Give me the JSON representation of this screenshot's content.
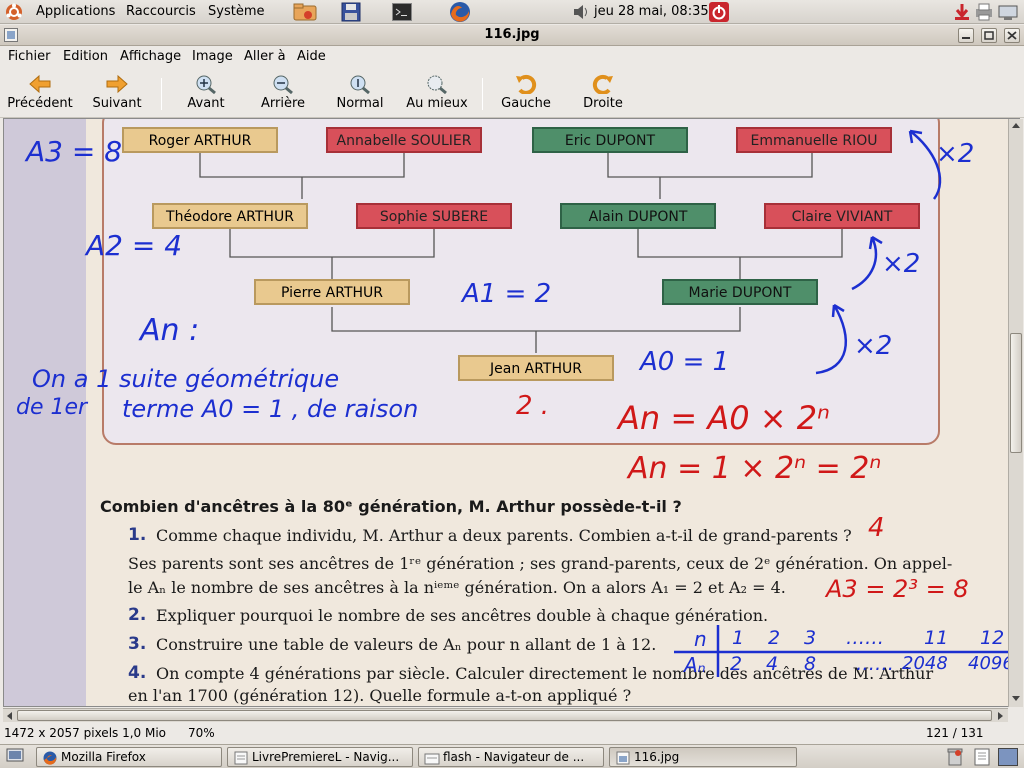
{
  "panel": {
    "applications": "Applications",
    "shortcuts": "Raccourcis",
    "system": "Système",
    "clock": "jeu 28 mai, 08:35"
  },
  "window": {
    "title": "116.jpg"
  },
  "menu": {
    "file": "Fichier",
    "edit": "Edition",
    "view": "Affichage",
    "image": "Image",
    "goto": "Aller à",
    "help": "Aide"
  },
  "toolbar": {
    "prev": "Précédent",
    "next": "Suivant",
    "zoom_in": "Avant",
    "zoom_out": "Arrière",
    "normal": "Normal",
    "best_fit": "Au mieux",
    "rotate_left": "Gauche",
    "rotate_right": "Droite"
  },
  "status": {
    "image_info": "1472 x 2057 pixels  1,0 Mio",
    "zoom": "70%",
    "position": "121 / 131"
  },
  "taskbar": [
    {
      "label": "Mozilla Firefox",
      "icon": "firefox-icon"
    },
    {
      "label": "LivrePremiereL - Navig...",
      "icon": "document-icon"
    },
    {
      "label": "flash - Navigateur de ...",
      "icon": "folder-icon"
    },
    {
      "label": "116.jpg",
      "icon": "image-icon"
    }
  ],
  "tree": {
    "gen3": [
      "Roger ARTHUR",
      "Annabelle SOULIER",
      "Eric DUPONT",
      "Emmanuelle RIOU"
    ],
    "gen2": [
      "Théodore ARTHUR",
      "Sophie SUBERE",
      "Alain DUPONT",
      "Claire VIVIANT"
    ],
    "gen1": [
      "Pierre ARTHUR",
      "Marie DUPONT"
    ],
    "gen0": "Jean ARTHUR"
  },
  "annotations": {
    "a3": "A3 = 8",
    "a2": "A2 = 4",
    "a1": "A1 = 2",
    "a0": "A0 = 1",
    "an": "An :",
    "x2": "×2",
    "line1": "On a 1 suite géométrique",
    "line2a": "de 1er",
    "line2b": "terme A0 = 1 , de raison",
    "line2c": "2 .",
    "formula1": "An = A0 × 2ⁿ",
    "formula2": "An = 1 × 2ⁿ = 2ⁿ",
    "answer1": "4",
    "answer3": "A3 = 2³ = 8"
  },
  "page": {
    "heading": "Combien d'ancêtres à la 80ᵉ génération, M. Arthur possède-t-il ?",
    "q1_num": "1.",
    "q1": "Comme chaque individu, M. Arthur a deux parents. Combien a-t-il de grand-parents ?",
    "p1": "Ses parents sont ses ancêtres de 1ʳᵉ génération ; ses grand-parents, ceux de 2ᵉ génération. On appel-",
    "p2": "le Aₙ le nombre de ses ancêtres à la nⁱᵉᵐᵉ génération. On a alors A₁ = 2 et A₂ = 4.",
    "q2_num": "2.",
    "q2": "Expliquer pourquoi le nombre de ses ancêtres double à chaque génération.",
    "q3_num": "3.",
    "q3": "Construire une table de valeurs de Aₙ pour n allant de 1 à 12.",
    "q4_num": "4.",
    "q4": "On compte 4 générations par siècle. Calculer directement le nombre des ancêtres de M. Arthur",
    "q4b": "en l'an 1700 (génération 12). Quelle formule a-t-on appliqué ?"
  },
  "table": {
    "n_label": "n",
    "a_label": "Aₙ",
    "n_values": [
      "1",
      "2",
      "3",
      "……",
      "11",
      "12"
    ],
    "a_values": [
      "2",
      "4",
      "8",
      "……",
      "2048",
      "4096"
    ]
  }
}
